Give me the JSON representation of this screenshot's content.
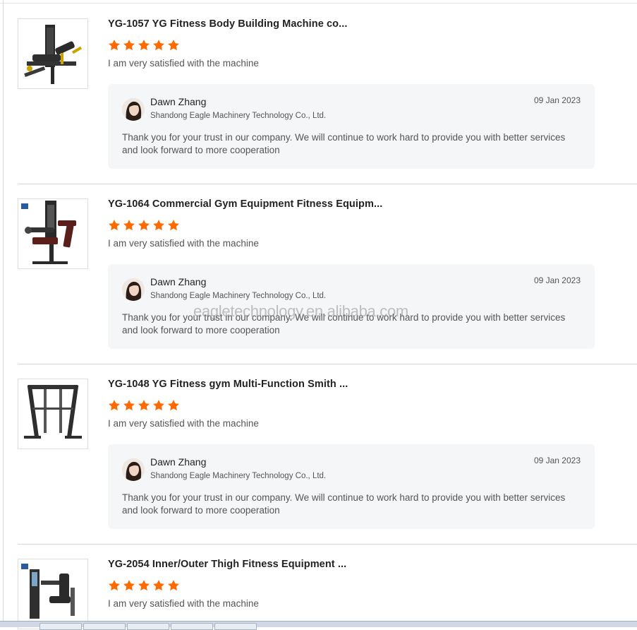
{
  "reviews": [
    {
      "title": "YG-1057 YG Fitness Body Building Machine co...",
      "rating": 5,
      "comment": "I am very satisfied with the machine",
      "reply": {
        "name": "Dawn Zhang",
        "company": "Shandong Eagle Machinery Technology Co., Ltd.",
        "date": "09 Jan 2023",
        "text": "Thank you for your trust in our company. We will continue to work hard to provide you with better services and look forward to more cooperation"
      }
    },
    {
      "title": "YG-1064 Commercial Gym Equipment Fitness Equipm...",
      "rating": 5,
      "comment": "I am very satisfied with the machine",
      "reply": {
        "name": "Dawn Zhang",
        "company": "Shandong Eagle Machinery Technology Co., Ltd.",
        "date": "09 Jan 2023",
        "text": "Thank you for your trust in our company. We will continue to work hard to provide you with better services and look forward to more cooperation"
      }
    },
    {
      "title": "YG-1048 YG Fitness gym Multi-Function Smith ...",
      "rating": 5,
      "comment": "I am very satisfied with the machine",
      "reply": {
        "name": "Dawn Zhang",
        "company": "Shandong Eagle Machinery Technology Co., Ltd.",
        "date": "09 Jan 2023",
        "text": "Thank you for your trust in our company. We will continue to work hard to provide you with better services and look forward to more cooperation"
      }
    },
    {
      "title": "YG-2054 Inner/Outer Thigh Fitness Equipment ...",
      "rating": 5,
      "comment": "I am very satisfied with the machine"
    }
  ],
  "watermark": "eagletechnology.en.alibaba.com",
  "colors": {
    "star": "#ff6a00",
    "reply_bg": "#f5f6f7"
  }
}
